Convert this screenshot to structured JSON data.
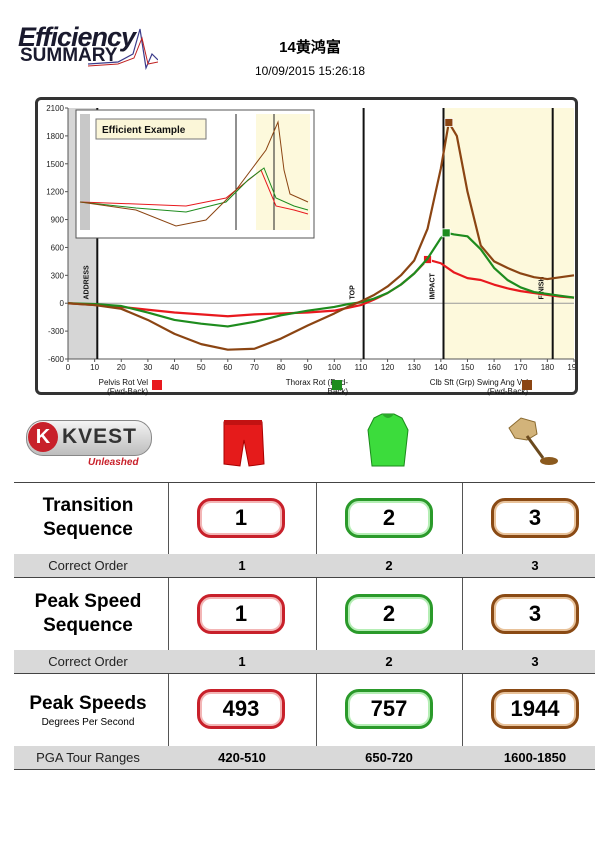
{
  "header": {
    "logo_line1": "Efficiency",
    "logo_line2": "SUMMARY",
    "name": "14黄鸿富",
    "datetime": "10/09/2015 15:26:18"
  },
  "chart_data": {
    "type": "line",
    "title": "",
    "xlabel": "",
    "ylabel": "",
    "xlim": [
      0,
      190
    ],
    "ylim": [
      -600,
      2100
    ],
    "x_ticks": [
      0,
      10,
      20,
      30,
      40,
      50,
      60,
      70,
      80,
      90,
      100,
      110,
      120,
      130,
      140,
      150,
      160,
      170,
      180,
      190
    ],
    "y_ticks": [
      -600,
      -300,
      0,
      300,
      600,
      900,
      1200,
      1500,
      1800,
      2100
    ],
    "phase_markers": [
      {
        "label": "ADDRESS",
        "x": 11
      },
      {
        "label": "TOP",
        "x": 111
      },
      {
        "label": "IMPACT",
        "x": 141
      },
      {
        "label": "FINISH",
        "x": 182
      }
    ],
    "series": [
      {
        "name": "Pelvis Rot Vel (Fwd-Back)",
        "color": "#e8191e",
        "x": [
          0,
          10,
          20,
          30,
          40,
          50,
          60,
          70,
          80,
          90,
          100,
          105,
          110,
          115,
          120,
          125,
          130,
          135,
          140,
          145,
          150,
          155,
          160,
          165,
          170,
          175,
          180,
          185,
          190
        ],
        "y": [
          0,
          -20,
          -40,
          -70,
          -100,
          -120,
          -140,
          -120,
          -110,
          -100,
          -80,
          -50,
          -20,
          40,
          110,
          200,
          320,
          470,
          430,
          330,
          270,
          250,
          200,
          160,
          130,
          110,
          90,
          70,
          60
        ]
      },
      {
        "name": "Thorax Rot (Fwd-Back)",
        "color": "#1e8c1e",
        "x": [
          0,
          10,
          20,
          30,
          40,
          50,
          60,
          70,
          80,
          90,
          100,
          105,
          110,
          115,
          120,
          125,
          130,
          135,
          140,
          142,
          145,
          150,
          155,
          160,
          165,
          170,
          175,
          180,
          185,
          190
        ],
        "y": [
          0,
          -10,
          -30,
          -100,
          -180,
          -220,
          -250,
          -200,
          -130,
          -80,
          -40,
          -10,
          10,
          50,
          110,
          200,
          320,
          480,
          700,
          757,
          740,
          720,
          580,
          380,
          250,
          170,
          120,
          100,
          80,
          60
        ]
      },
      {
        "name": "Clb Sft (Grp) Swing Ang Vel (Fwd-Back)",
        "color": "#8b4513",
        "x": [
          0,
          10,
          20,
          30,
          40,
          50,
          60,
          70,
          80,
          90,
          100,
          105,
          110,
          115,
          120,
          125,
          130,
          135,
          140,
          143,
          146,
          150,
          155,
          160,
          165,
          170,
          175,
          180,
          185,
          190
        ],
        "y": [
          0,
          -20,
          -60,
          -180,
          -330,
          -440,
          -500,
          -490,
          -380,
          -240,
          -110,
          -40,
          20,
          90,
          180,
          300,
          460,
          800,
          1450,
          1944,
          1800,
          1200,
          620,
          450,
          380,
          320,
          280,
          260,
          280,
          300
        ]
      }
    ],
    "grid": false,
    "legend": "bottom"
  },
  "inset": {
    "title": "Efficient Example"
  },
  "brand": {
    "name": "KVEST",
    "tagline": "Unleashed"
  },
  "rows": {
    "transition": {
      "label": "Transition Sequence",
      "values": [
        "1",
        "2",
        "3"
      ]
    },
    "correct1": {
      "label": "Correct Order",
      "values": [
        "1",
        "2",
        "3"
      ]
    },
    "peak_seq": {
      "label": "Peak Speed Sequence",
      "values": [
        "1",
        "2",
        "3"
      ]
    },
    "correct2": {
      "label": "Correct Order",
      "values": [
        "1",
        "2",
        "3"
      ]
    },
    "peak_speeds": {
      "label": "Peak Speeds",
      "sublabel": "Degrees Per Second",
      "values": [
        "493",
        "757",
        "1944"
      ]
    },
    "pga": {
      "label": "PGA Tour Ranges",
      "values": [
        "420-510",
        "650-720",
        "1600-1850"
      ]
    }
  },
  "colors": {
    "pelvis": "#e8191e",
    "thorax": "#1e8c1e",
    "club": "#8b4513"
  }
}
